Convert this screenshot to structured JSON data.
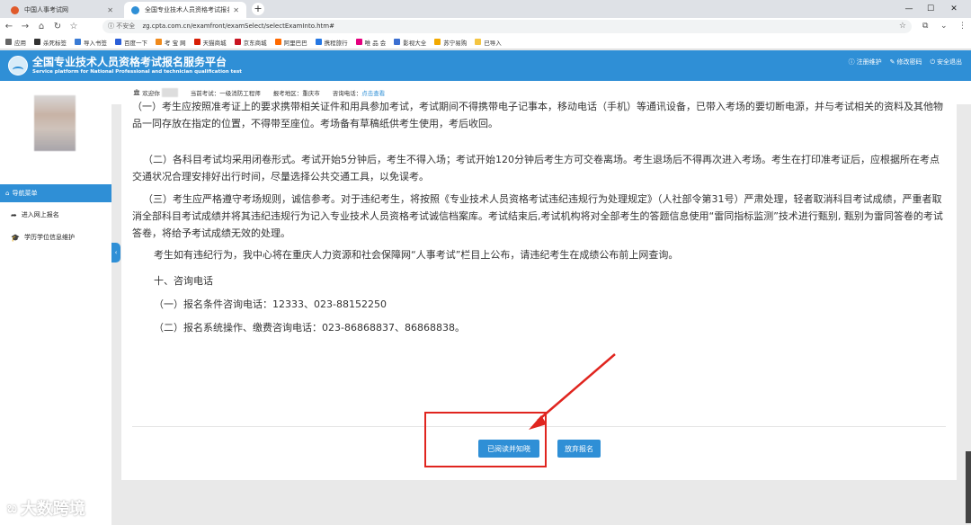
{
  "browser": {
    "tabs": [
      {
        "label": "中国人事考试网"
      },
      {
        "label": "全国专业技术人员资格考试报名！"
      }
    ],
    "new_tab": "+",
    "security": "不安全",
    "url": "zg.cpta.com.cn/examfront/examSelect/selectExamInto.htm#",
    "bookmarks": [
      {
        "label": "应用",
        "color": "#666666"
      },
      {
        "label": "杀死标签",
        "color": "#333333"
      },
      {
        "label": "导入书签",
        "color": "#3a7bd5"
      },
      {
        "label": "百度一下",
        "color": "#2b5fd8"
      },
      {
        "label": "考 宝 网",
        "color": "#f08a1c"
      },
      {
        "label": "天猫商城",
        "color": "#d81e06"
      },
      {
        "label": "京东商城",
        "color": "#c91623"
      },
      {
        "label": "阿里巴巴",
        "color": "#ff6a00"
      },
      {
        "label": "携程旅行",
        "color": "#2577e3"
      },
      {
        "label": "唯 品 会",
        "color": "#e4007f"
      },
      {
        "label": "影视大全",
        "color": "#3b6fd1"
      },
      {
        "label": "苏宁易购",
        "color": "#f2a900"
      },
      {
        "label": "已导入",
        "color": "#f4c542"
      }
    ]
  },
  "header": {
    "title": "全国专业技术人员资格考试报名服务平台",
    "subtitle": "Service platform for National Professional and technician qualification test",
    "links": [
      {
        "icon": "ⓘ",
        "label": "注册维护"
      },
      {
        "icon": "✎",
        "label": "修改密码"
      },
      {
        "icon": "⏻",
        "label": "安全退出"
      }
    ]
  },
  "sidebar": {
    "nav_title": "导航菜单",
    "items": [
      {
        "label": "进入网上报名"
      },
      {
        "label": "学历学位信息维护"
      }
    ]
  },
  "topinfo": {
    "welcome": "欢迎你",
    "exam": "当前考试：一级消防工程师",
    "area": "报考地区：重庆市",
    "phone_label": "咨询电话：",
    "phone_link": "点击查看"
  },
  "content": {
    "p1": "（一）考生应按照准考证上的要求携带相关证件和用具参加考试，考试期间不得携带电子记事本，移动电话（手机）等通讯设备，已带入考场的要切断电源，并与考试相关的资料及其他物品一同存放在指定的位置，不得带至座位。考场备有草稿纸供考生使用，考后收回。",
    "p2_num": "（二）",
    "p2": "各科目考试均采用闭卷形式。考试开始5分钟后，考生不得入场；考试开始120分钟后考生方可交卷离场。考生退场后不得再次进入考场。考生在打印准考证后，应根据所在考点交通状况合理安排好出行时间，尽量选择公共交通工具，以免误考。",
    "p3_num": "（三）",
    "p3": "考生应严格遵守考场规则，诚信参考。对于违纪考生，将按照《专业技术人员资格考试违纪违规行为处理规定》（人社部令第31号）严肃处理，轻者取消科目考试成绩，严重者取消全部科目考试成绩并将其违纪违规行为记入专业技术人员资格考试诚信档案库。考试结束后,考试机构将对全部考生的答题信息使用“雷同指标监测”技术进行甄别, 甄别为雷同答卷的考试答卷，将给予考试成绩无效的处理。",
    "p4": "考生如有违纪行为，我中心将在重庆人力资源和社会保障网“人事考试”栏目上公布，请违纪考生在成绩公布前上网查询。",
    "section10": "十、咨询电话",
    "phone1": "（一）报名条件咨询电话：12333、023-88152250",
    "phone2": "（二）报名系统操作、缴费咨询电话：023-86868837、86868838。"
  },
  "buttons": {
    "agree": "已阅读并知晓",
    "abandon": "放弃报名"
  },
  "watermark": "大数跨境",
  "colors": {
    "primary": "#2f8fd6",
    "annotation": "#e0251f"
  }
}
